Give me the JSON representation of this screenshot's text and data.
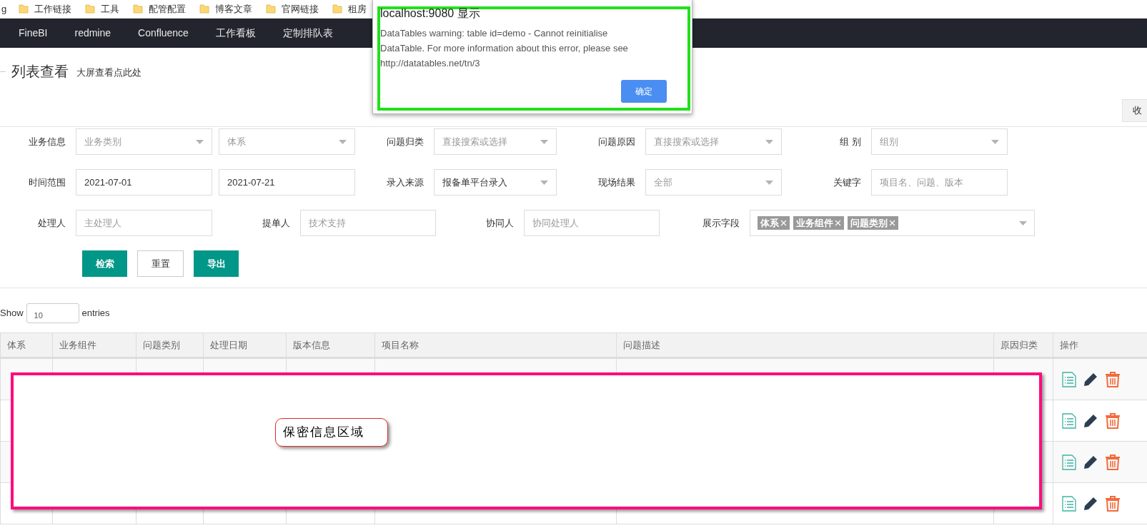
{
  "bookmarks": [
    {
      "label": "g",
      "kind": "cut"
    },
    {
      "label": "工作链接",
      "kind": "folder"
    },
    {
      "label": "工具",
      "kind": "folder"
    },
    {
      "label": "配管配置",
      "kind": "folder"
    },
    {
      "label": "博客文章",
      "kind": "folder"
    },
    {
      "label": "官网链接",
      "kind": "folder"
    },
    {
      "label": "租房",
      "kind": "folder"
    }
  ],
  "nav": [
    "FineBI",
    "redmine",
    "Confluence",
    "工作看板",
    "定制排队表"
  ],
  "page": {
    "title": "列表查看",
    "link": "大屏查看点此处",
    "collapse_button": "收"
  },
  "form": {
    "rows": [
      [
        {
          "label": "业务信息",
          "kind": "select",
          "placeholder": "业务类别"
        },
        {
          "kind": "select",
          "placeholder": "体系"
        },
        {
          "label": "问题归类",
          "kind": "select",
          "placeholder": "直接搜索或选择"
        },
        {
          "label": "问题原因",
          "kind": "select",
          "placeholder": "直接搜索或选择"
        },
        {
          "label": "组 别",
          "kind": "select",
          "placeholder": "组别"
        }
      ],
      [
        {
          "label": "时间范围",
          "kind": "input",
          "value": "2021-07-01"
        },
        {
          "kind": "input",
          "value": "2021-07-21"
        },
        {
          "label": "录入来源",
          "kind": "select",
          "value": "报备单平台录入"
        },
        {
          "label": "现场结果",
          "kind": "select",
          "placeholder": "全部"
        },
        {
          "label": "关键字",
          "kind": "input",
          "placeholder": "项目名、问题、版本"
        }
      ],
      [
        {
          "label": "处理人",
          "kind": "input",
          "placeholder": "主处理人"
        },
        {
          "label": "提单人",
          "kind": "input",
          "placeholder": "技术支持"
        },
        {
          "label": "协同人",
          "kind": "input",
          "placeholder": "协同处理人"
        },
        {
          "label": "展示字段",
          "kind": "tags",
          "tags": [
            "体系",
            "业务组件",
            "问题类别"
          ]
        }
      ]
    ],
    "buttons": [
      {
        "label": "检索",
        "kind": "primary"
      },
      {
        "label": "重置",
        "kind": "default"
      },
      {
        "label": "导出",
        "kind": "primary"
      }
    ]
  },
  "table": {
    "show_label": "Show",
    "page_size": "10",
    "entries_label": "entries",
    "columns": [
      "体系",
      "业务组件",
      "问题类别",
      "处理日期",
      "版本信息",
      "项目名称",
      "问题描述",
      "原因归类",
      "操作"
    ],
    "rows": [
      {
        "kind": "record"
      },
      {
        "kind": "record"
      },
      {
        "kind": "record"
      },
      {
        "kind": "record"
      }
    ]
  },
  "redaction": {
    "label": "保密信息区域"
  },
  "dialog": {
    "title": "localhost:9080 显示",
    "message": "DataTables warning: table id=demo - Cannot reinitialise DataTable. For more information about this error, please see http://datatables.net/tn/3",
    "ok": "确定"
  }
}
